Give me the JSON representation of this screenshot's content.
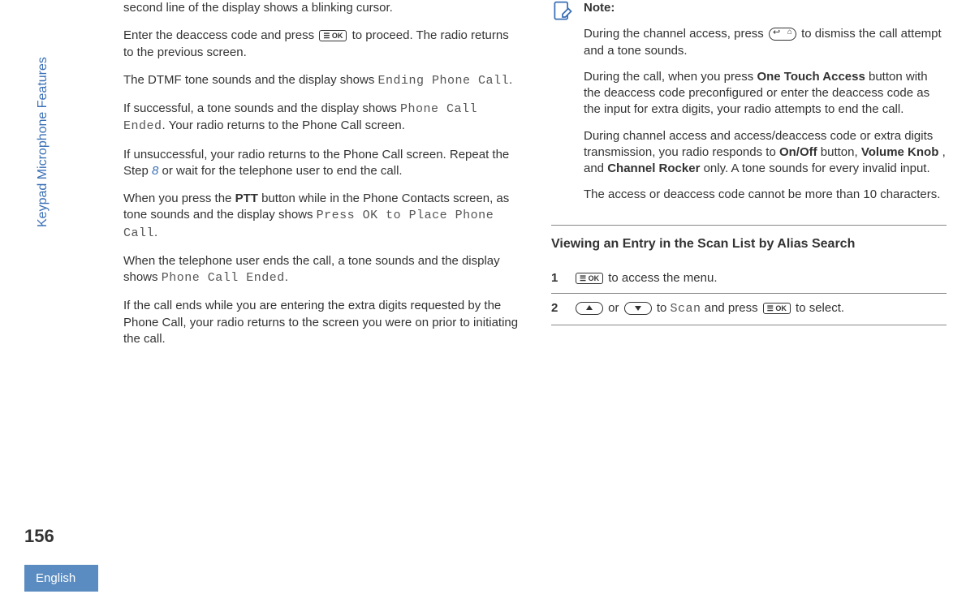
{
  "sideLabel": "Keypad Microphone Features",
  "pageNumber": "156",
  "language": "English",
  "left": {
    "p1": "second line of the display shows a blinking cursor.",
    "p2a": "Enter the deaccess code and press ",
    "p2b": " to proceed. The radio returns to the previous screen.",
    "p3a": "The DTMF tone sounds and the display shows ",
    "p3code": "Ending Phone Call",
    "p3b": ".",
    "p4a": "If successful, a tone sounds and the display shows ",
    "p4code": "Phone Call Ended",
    "p4b": ". Your radio returns to the Phone Call screen.",
    "p5a": "If unsuccessful, your radio returns to the Phone Call screen. Repeat the Step ",
    "p5step": "8",
    "p5b": " or wait for the telephone user to end the call.",
    "p6a": "When you press the ",
    "p6ptt": "PTT",
    "p6b": " button while in the Phone Contacts screen, as tone sounds and the display shows ",
    "p6code": "Press OK to Place Phone Call",
    "p6c": ".",
    "p7a": "When the telephone user ends the call, a tone sounds and the display shows ",
    "p7code": "Phone Call Ended",
    "p7b": ".",
    "p8": "If the call ends while you are entering the extra digits requested by the Phone Call, your radio returns to the screen you were on prior to initiating the call."
  },
  "right": {
    "noteTitle": "Note:",
    "n1a": "During the channel access, press ",
    "n1b": " to dismiss the call attempt and a tone sounds.",
    "n2a": "During the call, when you press ",
    "n2bold": "One Touch Access",
    "n2b": " button with the deaccess code preconfigured or enter the deaccess code as the input for extra digits, your radio attempts to end the call.",
    "n3a": "During channel access and access/deaccess code or extra digits transmission, you radio responds to ",
    "n3b1": "On/Off",
    "n3b2": " button, ",
    "n3b3": "Volume Knob",
    "n3b4": ", and ",
    "n3b5": "Channel Rocker",
    "n3b6": " only. A tone sounds for every invalid input.",
    "n4": "The access or deaccess code cannot be more than 10 characters.",
    "sectionTitle": "Viewing an Entry in the Scan List by Alias Search",
    "step1num": "1",
    "step1text": " to access the menu.",
    "step2num": "2",
    "step2or": " or ",
    "step2to": " to ",
    "step2scan": "Scan",
    "step2and": " and press ",
    "step2sel": " to select."
  },
  "okLabel": "☰ OK"
}
